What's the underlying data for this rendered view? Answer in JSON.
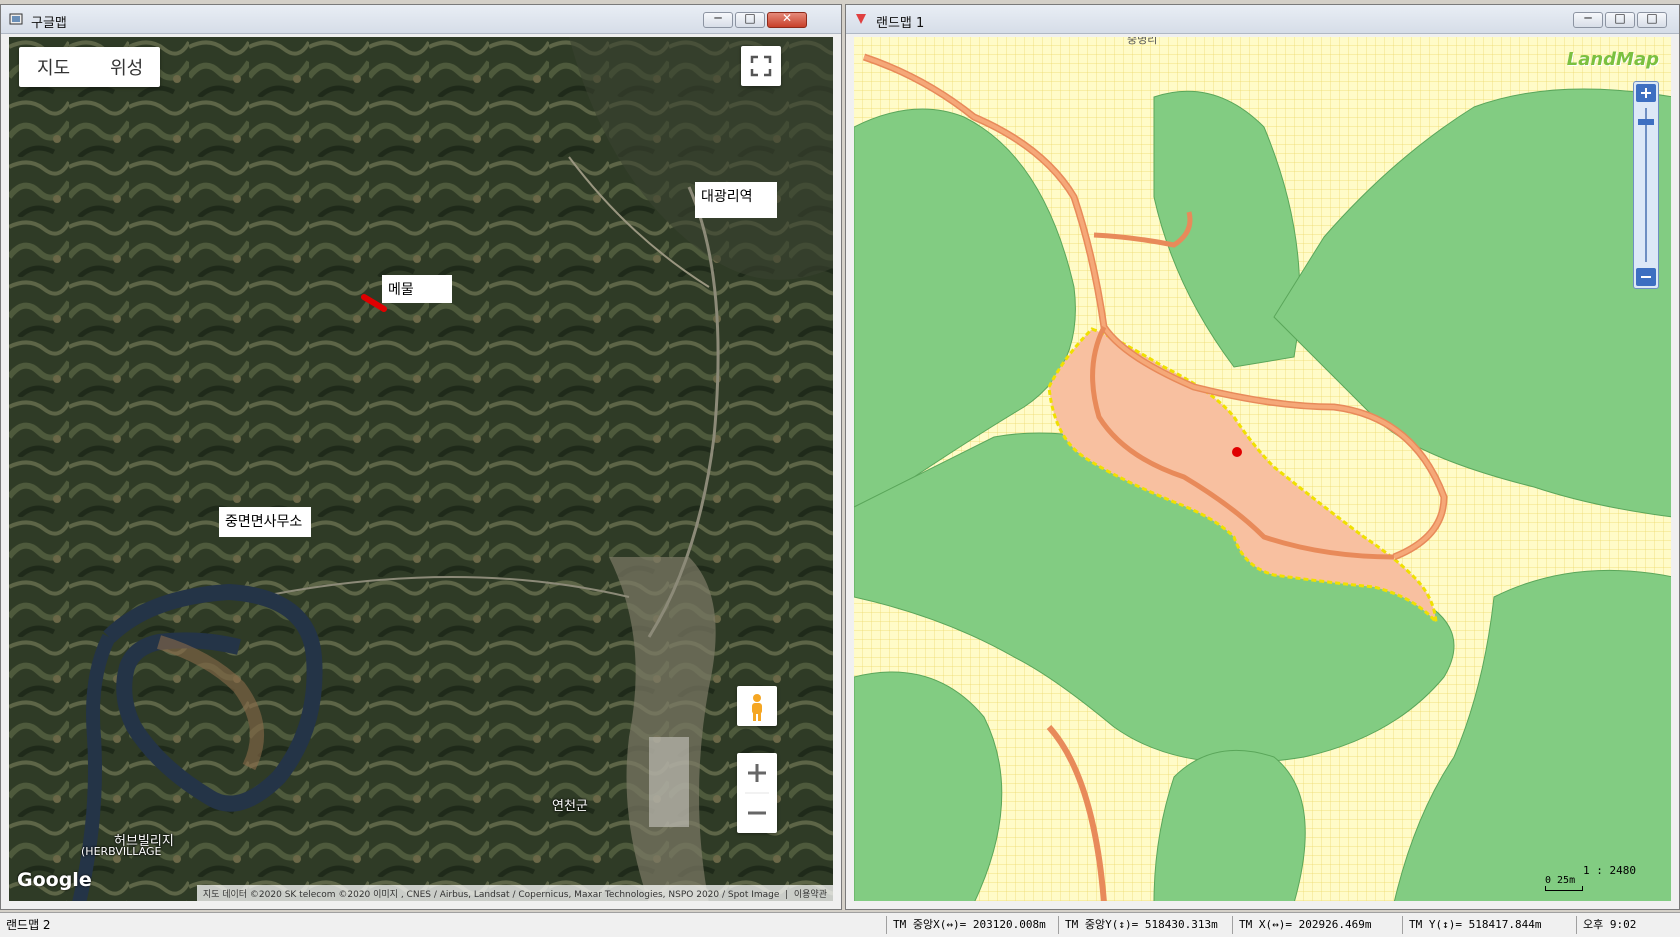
{
  "left_window": {
    "title": "구글맵",
    "controls": {
      "minimize": "─",
      "maximize": "□",
      "close": "✕"
    },
    "map_type": {
      "map_label": "지도",
      "satellite_label": "위성"
    },
    "labels": {
      "station": "대광리역",
      "marker": "메물",
      "office": "중면면사무소"
    },
    "places": {
      "town": "연천군",
      "village": "허브빌리지",
      "village_en": "(HERBVILLAGE"
    },
    "google_logo": "Google",
    "attribution": "지도 데이터 ©2020 SK telecom ©2020 이미지 , CNES / Airbus, Landsat / Copernicus, Maxar Technologies, NSPO 2020 / Spot Image",
    "terms": "이용약관",
    "icons": {
      "fullscreen": "fullscreen-icon",
      "pegman": "pegman-icon",
      "zoom_in": "plus-icon",
      "zoom_out": "minus-icon"
    }
  },
  "right_window": {
    "title": "랜드맵 1",
    "logo": "LandMap",
    "top_label": "중명리",
    "scale_ratio": "1 : 2480",
    "scale_bar": "0   25m",
    "colors": {
      "forest": "#82cc82",
      "field": "#fffbc8",
      "road": "#f0a070",
      "parcel": "#f8c0a0",
      "boundary": "#f0e000",
      "marker": "#e00000"
    }
  },
  "status_bar": {
    "app": "랜드맵 2",
    "tm_center_x": "TM 중앙X(↔)= 203120.008m",
    "tm_center_y": "TM 중앙Y(↕)= 518430.313m",
    "tm_x": "TM X(↔)= 202926.469m",
    "tm_y": "TM Y(↕)= 518417.844m",
    "time": "오후 9:02"
  }
}
